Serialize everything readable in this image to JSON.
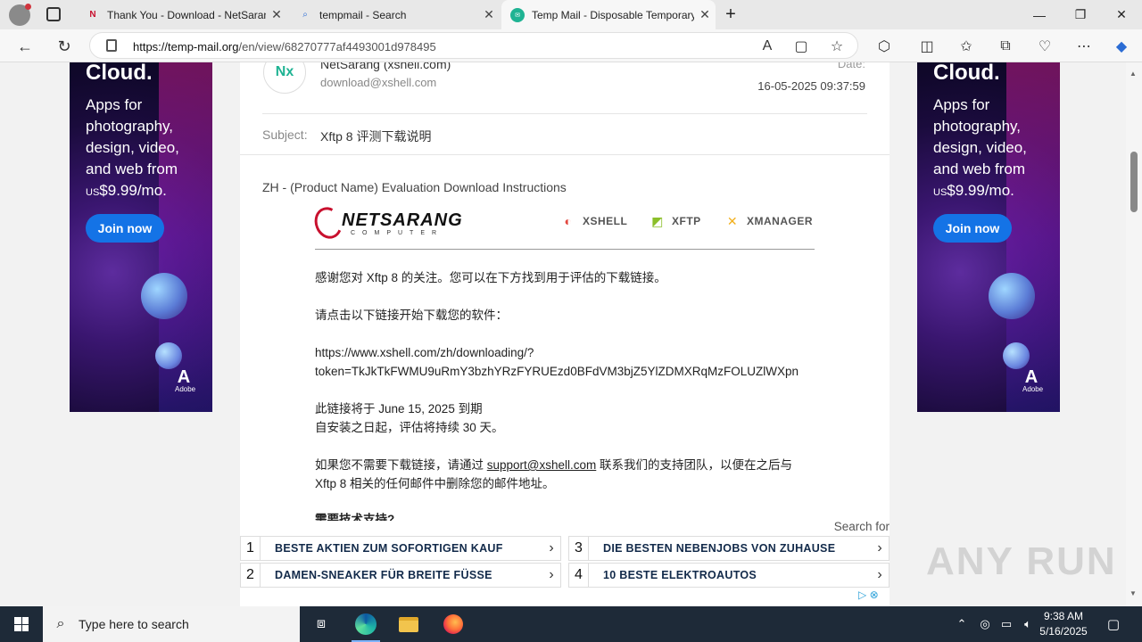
{
  "browser": {
    "tabs": [
      {
        "title": "Thank You - Download - NetSarang",
        "close": "✕"
      },
      {
        "title": "tempmail - Search",
        "close": "✕"
      },
      {
        "title": "Temp Mail - Disposable Temporary",
        "close": "✕"
      }
    ],
    "new_tab": "+",
    "url_domain": "https://temp-mail.org",
    "url_path": "/en/view/68270777af4493001d978495"
  },
  "ads": {
    "headline": "Cloud.",
    "copy_1": "Apps for",
    "copy_2": "photography,",
    "copy_3": "design, video,",
    "copy_4": "and web from",
    "copy_price_prefix": "US",
    "copy_price": "$9.99/mo.",
    "button": "Join now",
    "brand": "Adobe"
  },
  "email": {
    "avatar": "Nx",
    "from_name": "NetSarang (xshell.com)",
    "from_email": "download@xshell.com",
    "date_label": "Date:",
    "date": "16-05-2025 09:37:59",
    "subject_label": "Subject:",
    "subject": "Xftp 8 评测下载说明",
    "preheader": "ZH - (Product Name) Evaluation Download Instructions",
    "brand": {
      "logo_name": "NETSARANG",
      "logo_sub": "COMPUTER",
      "products": [
        "XSHELL",
        "XFTP",
        "XMANAGER"
      ]
    },
    "body": {
      "p1": "感谢您对 Xftp 8 的关注。您可以在下方找到用于评估的下载链接。",
      "p2": "请点击以下链接开始下载您的软件：",
      "link_1": "https://www.xshell.com/zh/downloading/?",
      "link_2": "token=TkJkTkFWMU9uRmY3bzhYRzFYRUEzd0BFdVM3bjZ5YlZDMXRqMzFOLUZlWXpn",
      "p3a": "此链接将于 June 15, 2025 到期",
      "p3b": "自安装之日起，评估将持续 30 天。",
      "p4_pre": "如果您不需要下载链接，请通过 ",
      "p4_link": "support@xshell.com",
      "p4_post": " 联系我们的支持团队，以便在之后与",
      "p4_line2": "Xftp 8 相关的任何邮件中删除您的邮件地址。",
      "p5": "需要技术支持?"
    }
  },
  "sponsored": {
    "search_for": "Search for",
    "items": [
      {
        "num": "1",
        "text": "BESTE AKTIEN ZUM SOFORTIGEN KAUF"
      },
      {
        "num": "2",
        "text": "DAMEN-SNEAKER FÜR BREITE FÜSSE"
      },
      {
        "num": "3",
        "text": "DIE BESTEN NEBENJOBS VON ZUHAUSE"
      },
      {
        "num": "4",
        "text": "10 BESTE ELEKTROAUTOS"
      }
    ]
  },
  "watermark": "ANY RUN",
  "taskbar": {
    "search_placeholder": "Type here to search",
    "time": "9:38 AM",
    "date": "5/16/2025"
  },
  "colors": {
    "accent_teal": "#1fb393",
    "ad_button": "#1473e6",
    "netsarang_red": "#c8102e"
  }
}
